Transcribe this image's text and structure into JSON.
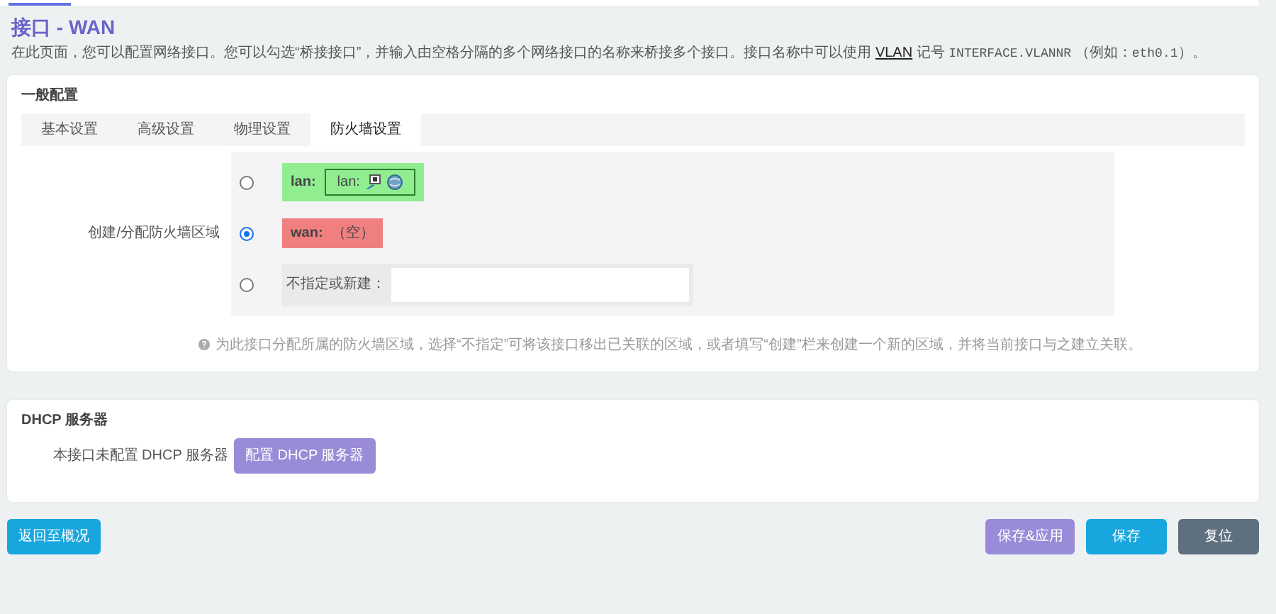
{
  "page": {
    "title": "接口 - WAN",
    "description": [
      {
        "kind": "text",
        "text": "在此页面，您可以配置网络接口。您可以勾选“桥接接口”，并输入由空格分隔的多个网络接口的名称来桥接多个接口。接口名称中可以使用 "
      },
      {
        "kind": "link",
        "text": "VLAN"
      },
      {
        "kind": "text",
        "text": " 记号 "
      },
      {
        "kind": "code",
        "text": "INTERFACE.VLANNR"
      },
      {
        "kind": "text",
        "text": " （例如："
      },
      {
        "kind": "code",
        "text": "eth0.1"
      },
      {
        "kind": "text",
        "text": "）。"
      }
    ]
  },
  "general": {
    "title": "一般配置",
    "tabs": [
      {
        "label": "基本设置",
        "selected": false
      },
      {
        "label": "高级设置",
        "selected": false
      },
      {
        "label": "物理设置",
        "selected": false
      },
      {
        "label": "防火墙设置",
        "selected": true
      }
    ],
    "firewall_zone": {
      "label": "创建/分配防火墙区域",
      "options": [
        {
          "kind": "zone",
          "zone": "lan:",
          "color": "#90ee90",
          "selected": false,
          "networks": [
            "lan:"
          ]
        },
        {
          "kind": "zone",
          "zone": "wan:",
          "color": "#f08080",
          "selected": true,
          "empty": "（空）"
        },
        {
          "kind": "custom",
          "label": "不指定或新建：",
          "selected": false
        }
      ],
      "help": "为此接口分配所属的防火墙区域，选择“不指定”可将该接口移出已关联的区域，或者填写“创建”栏来创建一个新的区域，并将当前接口与之建立关联。"
    }
  },
  "dhcp": {
    "title": "DHCP 服务器",
    "note": "本接口未配置 DHCP 服务器",
    "button": "配置 DHCP 服务器"
  },
  "footer": {
    "back": "返回至概况",
    "actions": [
      {
        "kind": "apply",
        "label": "保存&应用"
      },
      {
        "kind": "save",
        "label": "保存"
      },
      {
        "kind": "reset",
        "label": "复位"
      }
    ]
  }
}
